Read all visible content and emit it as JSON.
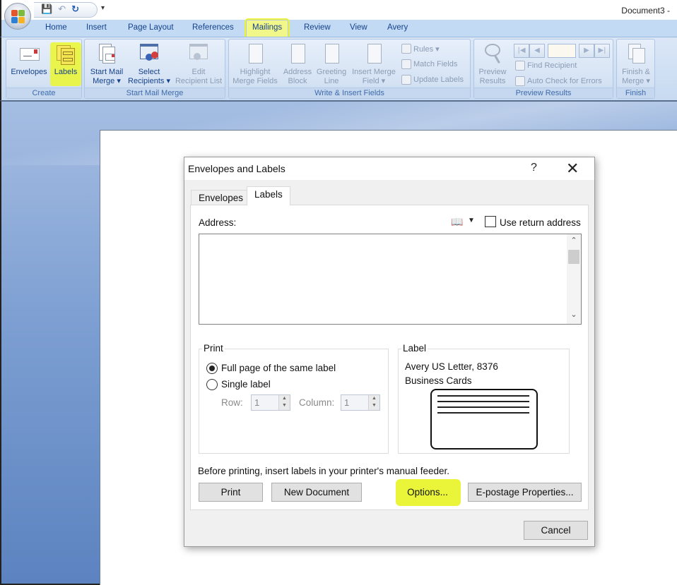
{
  "window": {
    "doc_title": "Document3 -",
    "qat": {
      "save": "save-icon",
      "undo": "undo-icon",
      "redo": "redo-icon",
      "customize": "▾"
    }
  },
  "tabs": [
    "Home",
    "Insert",
    "Page Layout",
    "References",
    "Mailings",
    "Review",
    "View",
    "Avery"
  ],
  "active_tab": "Mailings",
  "ribbon": {
    "create": {
      "label": "Create",
      "envelopes": "Envelopes",
      "labels": "Labels"
    },
    "start_mail_merge": {
      "label": "Start Mail Merge",
      "start_mail_merge_1": "Start Mail",
      "start_mail_merge_2": "Merge ▾",
      "select_recipients_1": "Select",
      "select_recipients_2": "Recipients ▾",
      "edit_recipient_list_1": "Edit",
      "edit_recipient_list_2": "Recipient List"
    },
    "write_insert": {
      "label": "Write & Insert Fields",
      "highlight_1": "Highlight",
      "highlight_2": "Merge Fields",
      "address_1": "Address",
      "address_2": "Block",
      "greeting_1": "Greeting",
      "greeting_2": "Line",
      "insert_merge_1": "Insert Merge",
      "insert_merge_2": "Field ▾",
      "rules": "Rules ▾",
      "match_fields": "Match Fields",
      "update_labels": "Update Labels"
    },
    "preview": {
      "label": "Preview Results",
      "preview_1": "Preview",
      "preview_2": "Results",
      "record_value": "",
      "find_recipient": "Find Recipient",
      "auto_check": "Auto Check for Errors"
    },
    "finish": {
      "label": "Finish",
      "finish_1": "Finish &",
      "finish_2": "Merge ▾"
    }
  },
  "dialog": {
    "title": "Envelopes and Labels",
    "help": "?",
    "close": "✕",
    "tabs": {
      "envelopes": "Envelopes",
      "labels": "Labels",
      "active": "Labels"
    },
    "address_label": "Address:",
    "address_value": "",
    "use_return_address": {
      "label": "Use return address",
      "checked": false
    },
    "print": {
      "legend": "Print",
      "full_page": "Full page of the same label",
      "single_label": "Single label",
      "selected": "Full page of the same label",
      "row_label": "Row:",
      "row_value": "1",
      "column_label": "Column:",
      "column_value": "1"
    },
    "label": {
      "legend": "Label",
      "line1": "Avery US Letter, 8376",
      "line2": "Business Cards"
    },
    "feeder_note": "Before printing, insert labels in your printer's manual feeder.",
    "buttons": {
      "print": "Print",
      "new_document": "New Document",
      "options": "Options...",
      "epostage": "E-postage Properties...",
      "cancel": "Cancel"
    }
  },
  "highlight_color": "#eaf53a"
}
